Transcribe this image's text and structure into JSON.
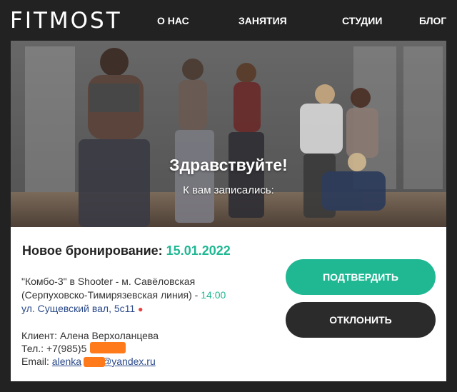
{
  "header": {
    "logo": "FITMOST",
    "nav": [
      "О НАС",
      "ЗАНЯТИЯ",
      "СТУДИИ",
      "БЛОГ"
    ]
  },
  "hero": {
    "title": "Здравствуйте!",
    "subtitle": "К вам записались:"
  },
  "booking": {
    "title_prefix": "Новое бронирование:",
    "date": "15.01.2022",
    "class_line1": "\"Комбо-3\" в Shooter - м. Савёловская",
    "class_line2": "(Серпуховско-Тимирязевская линия) - ",
    "time": "14:00",
    "address": "ул. Сущевский вал, 5с11",
    "client_label": "Клиент:",
    "client_name": "Алена Верхоланцева",
    "phone_label": "Тел.:",
    "phone": "+7(985)5",
    "email_label": "Email:",
    "email_start": "alenka",
    "email_end": "@yandex.ru"
  },
  "buttons": {
    "confirm": "ПОДТВЕРДИТЬ",
    "decline": "ОТКЛОНИТЬ"
  },
  "colors": {
    "accent": "#1fb893",
    "dark": "#222222",
    "link": "#2b4a8a"
  }
}
